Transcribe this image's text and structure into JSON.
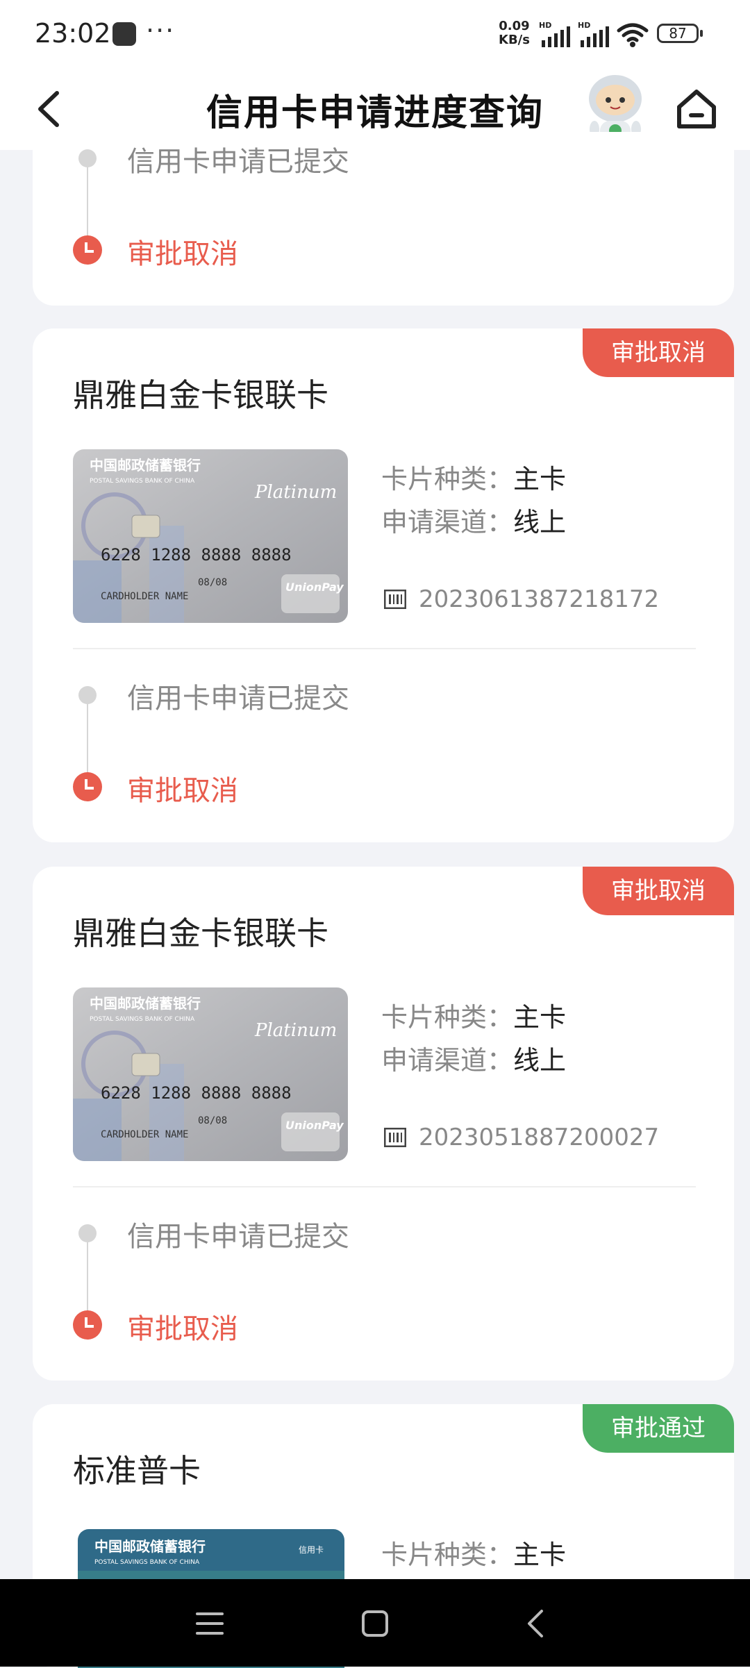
{
  "status_bar": {
    "time": "23:02",
    "more": "···",
    "net_speed_value": "0.09",
    "net_speed_unit": "KB/s",
    "signal1_label": "HD",
    "signal2_label": "HD",
    "battery": "87"
  },
  "header": {
    "title": "信用卡申请进度查询",
    "back_icon": "chevron-left-icon",
    "assistant_icon": "robot-assistant-icon",
    "home_icon": "home-icon"
  },
  "top_card": {
    "step1": "信用卡申请已提交",
    "step2": "审批取消"
  },
  "cards": [
    {
      "status": "审批取消",
      "title": "鼎雅白金卡银联卡",
      "type_label": "卡片种类：",
      "type_value": "主卡",
      "channel_label": "申请渠道：",
      "channel_value": "线上",
      "application_no": "2023061387218172",
      "step1": "信用卡申请已提交",
      "step2": "审批取消"
    },
    {
      "status": "审批取消",
      "title": "鼎雅白金卡银联卡",
      "type_label": "卡片种类：",
      "type_value": "主卡",
      "channel_label": "申请渠道：",
      "channel_value": "线上",
      "application_no": "2023051887200027",
      "step1": "信用卡申请已提交",
      "step2": "审批取消"
    },
    {
      "status": "审批通过",
      "title": "标准普卡",
      "type_label": "卡片种类：",
      "type_value": "主卡"
    }
  ],
  "card_image": {
    "bank_cn": "中国邮政储蓄银行",
    "bank_en": "POSTAL SAVINGS BANK OF CHINA",
    "platinum": "Platinum",
    "number": "6228 1288 8888 8888",
    "holder": "CARDHOLDER NAME",
    "expiry": "08/08",
    "unionpay": "UnionPay",
    "credit_label": "信用卡"
  },
  "colors": {
    "accent_red": "#e85c4d",
    "accent_green": "#4caf63",
    "background": "#f2f3f7"
  },
  "nav": {
    "menu_icon": "menu-icon",
    "home_icon": "square-home-icon",
    "back_icon": "back-triangle-icon"
  }
}
